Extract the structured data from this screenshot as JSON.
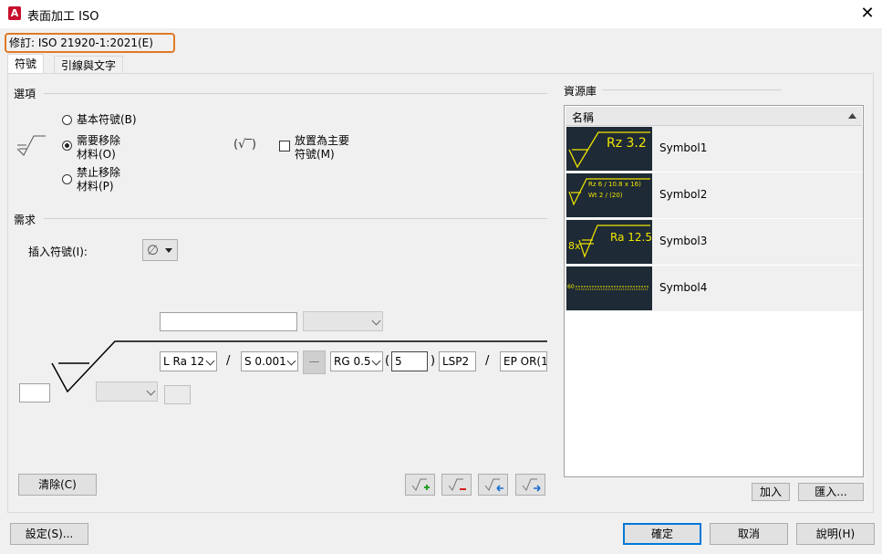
{
  "window": {
    "title": "表面加工 ISO",
    "close_glyph": "✕",
    "app_icon_letter": "A"
  },
  "revision": "修訂: ISO 21920-1:2021(E)",
  "tabs": [
    {
      "label": "符號",
      "active": true
    },
    {
      "label": "引線與文字",
      "active": false
    }
  ],
  "options": {
    "group_label": "選項",
    "radio_basic": "基本符號(B)",
    "radio_remove_line1": "需要移除",
    "radio_remove_line2": "材料(O)",
    "radio_prohibit_line1": "禁止移除",
    "radio_prohibit_line2": "材料(P)",
    "selected": "remove",
    "paren_symbol": "(√‾)",
    "checkbox_line1": "放置為主要",
    "checkbox_line2": "符號(M)",
    "checkbox_checked": false
  },
  "requirements": {
    "group_label": "需求",
    "insert_symbol_label": "插入符號(I):",
    "insert_symbol_glyph": "∅",
    "field_top_value": "",
    "select_top_value": "",
    "select_ra": "L Ra 12",
    "slash_1": "/",
    "select_s": "S 0.001",
    "dash_button": "—",
    "select_rg": "RG 0.5",
    "paren_open": "(",
    "field_5": "5",
    "paren_close": ")",
    "field_lsp": "LSP2",
    "slash_2": "/",
    "field_ep": "EP OR(1",
    "field_left_value": "",
    "select_bottom_value": "",
    "field_bottom_value": ""
  },
  "buttons": {
    "clear": "清除(C)",
    "add": "加入",
    "import": "匯入...",
    "settings": "設定(S)...",
    "ok": "確定",
    "cancel": "取消",
    "help": "說明(H)"
  },
  "library": {
    "group_label": "資源庫",
    "column_name": "名稱",
    "items": [
      {
        "name": "Symbol1",
        "preview_text": "Rz 3.2"
      },
      {
        "name": "Symbol2",
        "preview_line1": "Rz 6 / 10.8 x 16)",
        "preview_line2": "Wt 2 / (20)"
      },
      {
        "name": "Symbol3",
        "preview_prefix": "8x",
        "preview_text": "Ra 12.5"
      },
      {
        "name": "Symbol4",
        "preview_text": "60"
      }
    ]
  },
  "colors": {
    "accent": "#0078d7",
    "revision_border": "#e07a24",
    "symbol_yellow": "#f2e600",
    "symbol_bg": "#1e2a36"
  }
}
